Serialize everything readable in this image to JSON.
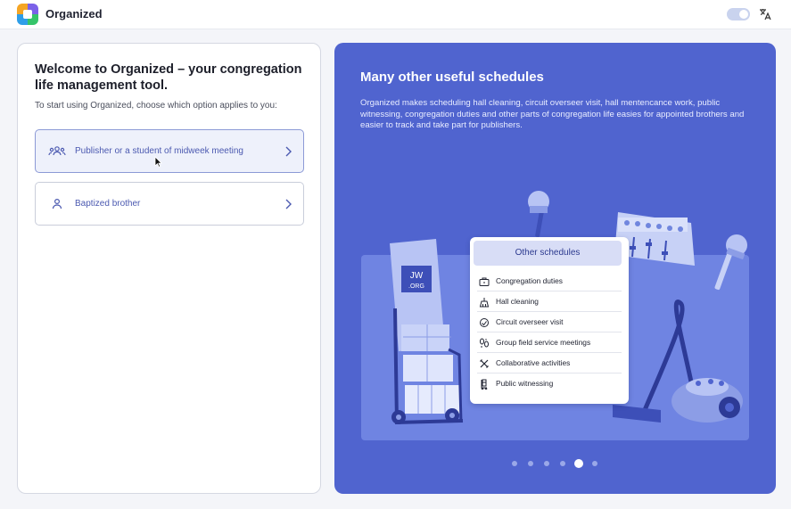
{
  "header": {
    "app_title": "Organized",
    "logo_icon": "organized-logo-icon",
    "theme_toggle_icon": "theme-toggle",
    "language_icon": "translate-icon"
  },
  "welcome": {
    "title": "Welcome to Organized – your congregation life management tool.",
    "subtitle": "To start using Organized, choose which option applies to you:",
    "options": [
      {
        "label": "Publisher or a student of midweek meeting",
        "icon": "people-group-icon",
        "selected": true
      },
      {
        "label": "Baptized brother",
        "icon": "person-icon",
        "selected": false
      }
    ]
  },
  "slide": {
    "title": "Many other useful schedules",
    "description": "Organized makes scheduling hall cleaning, circuit overseer visit, hall mentencance work, public witnessing, congregation duties and other parts of congregation life easies for appointed brothers and easier to track and take part for publishers.",
    "card_title": "Other schedules",
    "items": [
      {
        "label": "Congregation duties",
        "icon": "briefcase-icon"
      },
      {
        "label": "Hall cleaning",
        "icon": "cleaning-icon"
      },
      {
        "label": "Circuit overseer visit",
        "icon": "handshake-icon"
      },
      {
        "label": "Group field service meetings",
        "icon": "footprints-icon"
      },
      {
        "label": "Collaborative activities",
        "icon": "tools-icon"
      },
      {
        "label": "Public witnessing",
        "icon": "cart-icon"
      }
    ],
    "cart_sign": [
      "JW",
      ".ORG"
    ],
    "carousel": {
      "count": 6,
      "active_index": 4
    }
  },
  "colors": {
    "accent": "#5064cf",
    "accent_text": "#4b59b0",
    "selected_bg": "#eef1fb"
  }
}
